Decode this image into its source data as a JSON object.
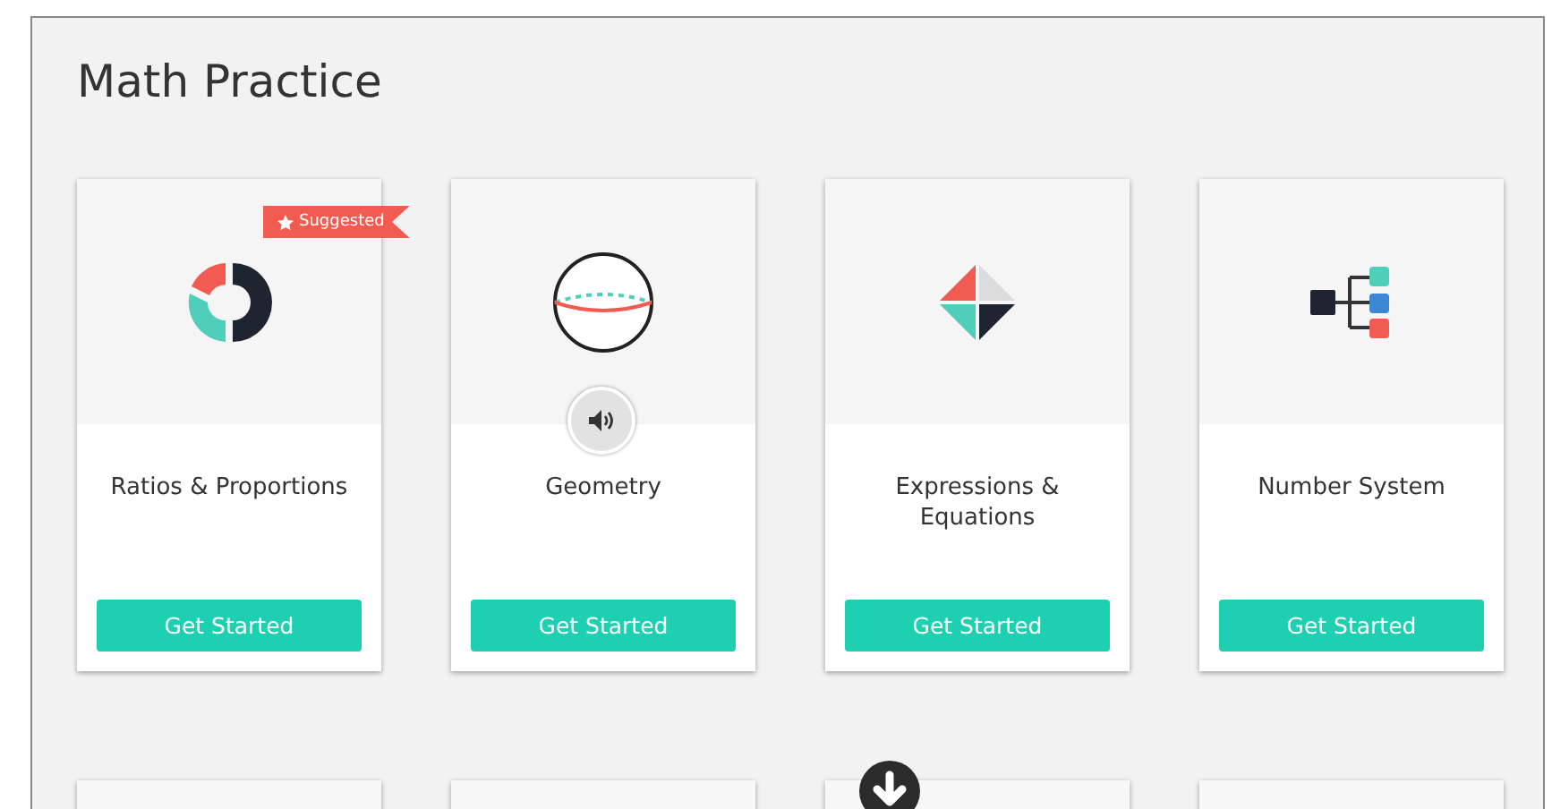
{
  "title": "Math Practice",
  "cards": [
    {
      "title": "Ratios & Proportions",
      "badge": "Suggested",
      "audio": false,
      "button": "Get Started"
    },
    {
      "title": "Geometry",
      "audio": true,
      "button": "Get Started"
    },
    {
      "title": "Expressions & Equations",
      "audio": false,
      "button": "Get Started"
    },
    {
      "title": "Number System",
      "audio": false,
      "button": "Get Started"
    }
  ]
}
